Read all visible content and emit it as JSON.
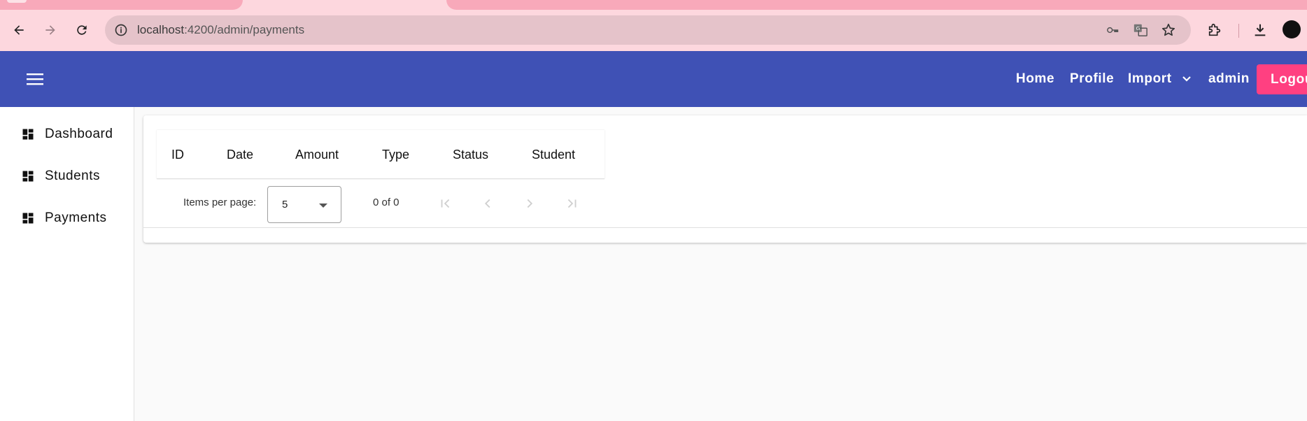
{
  "browser": {
    "url_host": "localhost",
    "url_path": ":4200/admin/payments"
  },
  "header": {
    "nav": [
      "Home",
      "Profile",
      "Import",
      "admin"
    ],
    "logout_label": "Logout"
  },
  "sidebar": {
    "items": [
      {
        "label": "Dashboard",
        "icon": "dashboard-icon"
      },
      {
        "label": "Students",
        "icon": "dashboard-icon"
      },
      {
        "label": "Payments",
        "icon": "dashboard-icon"
      }
    ]
  },
  "table": {
    "columns": [
      "ID",
      "Date",
      "Amount",
      "Type",
      "Status",
      "Student"
    ]
  },
  "paginator": {
    "items_per_page_label": "Items per page:",
    "page_size": "5",
    "range_label": "0 of 0"
  },
  "colors": {
    "header": "#3f51b5",
    "accent": "#ff4081",
    "chrome": "#fdd7de"
  }
}
